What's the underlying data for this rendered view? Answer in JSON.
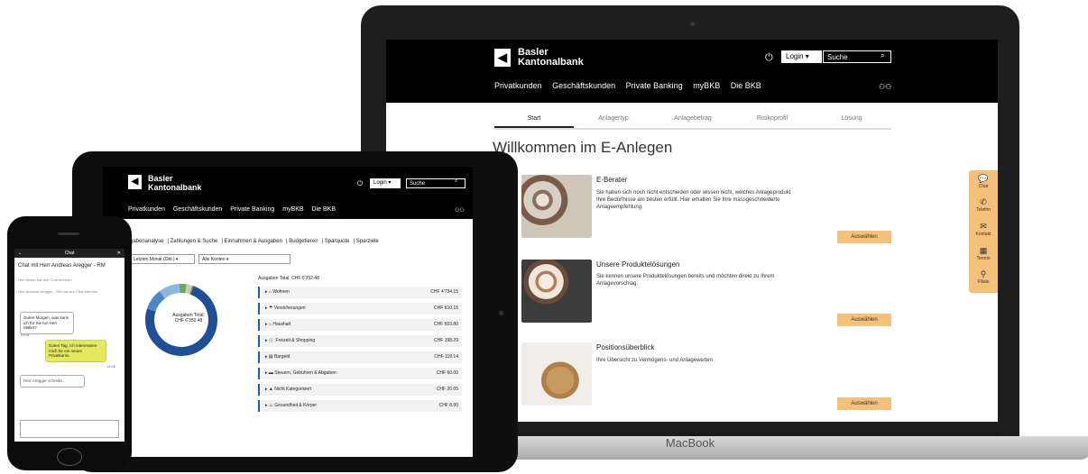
{
  "brand": {
    "line1": "Basler",
    "line2": "Kantonalbank"
  },
  "login_label": "Login",
  "search_placeholder": "Suche",
  "device_label": "MacBook",
  "nav": [
    "Privatkunden",
    "Geschäftskunden",
    "Private Banking",
    "myBKB",
    "Die BKB"
  ],
  "laptop": {
    "tabs": [
      "Start",
      "Anlagertyp",
      "Anlagebetrag",
      "Risikoprofil",
      "Lösung"
    ],
    "title": "Willkommen im E-Anlegen",
    "cards": [
      {
        "title": "E-Berater",
        "text": "Sie haben sich noch nicht entschieden oder wissen nicht, welches Anlageprodukt Ihre Bedürfnisse am besten erfüllt. Hier erhalten Sie Ihre massgeschneiderte Anlageempfehlung.",
        "button": "Auswählen"
      },
      {
        "title": "Unsere Produktelösungen",
        "text": "Sie kennen unsere Produktelösungen bereits und möchten direkt zu Ihrem Anlagevorschlag.",
        "button": "Auswählen"
      },
      {
        "title": "Positionsüberblick",
        "text": "Ihre Übersicht zu Vermögens- und Anlagewerten.",
        "button": "Auswählen"
      }
    ],
    "side": [
      "Chat",
      "Telefon",
      "Kontakt",
      "Termin",
      "Filiale"
    ]
  },
  "tablet": {
    "subnav": [
      "gabenanalyse",
      "Zahlungen & Suche",
      "Einnahmen & Ausgaben",
      "Budgetieren",
      "Sparquote",
      "Sparziele"
    ],
    "filter_period": "Letzten Monat (Okt.)",
    "filter_accounts": "Alle Konten",
    "donut_label": "Ausgaben Total:",
    "donut_value": "CHF 6'352.48",
    "total_label": "Ausgaben Total:  CHF 6'352.48",
    "rows": [
      {
        "label": "Wohnen",
        "value": "CHF 4'734.15"
      },
      {
        "label": "Versicherungen",
        "value": "CHF 610.15"
      },
      {
        "label": "Haushalt",
        "value": "CHF 603.80"
      },
      {
        "label": "Freizeit & Shopping",
        "value": "CHF 198.29"
      },
      {
        "label": "Bargeld",
        "value": "CHF 119.14"
      },
      {
        "label": "Steuern, Gebühren & Abgaben",
        "value": "CHF 60.00"
      },
      {
        "label": "Nicht Kategorisiert",
        "value": "CHF 20.05"
      },
      {
        "label": "Gesundheit & Körper",
        "value": "CHF 8.90"
      }
    ],
    "donut_colors": [
      "#1f4f95",
      "#4d87c7",
      "#8fb8e0",
      "#6aa84f",
      "#c9c9c9",
      "#e6c34a"
    ]
  },
  "phone": {
    "bar_title": "Chat",
    "chat_title": "Chat mit Herr Andreas Aregger - RM",
    "sys1": "Herr Müller hat den Chat betreten",
    "sys2": "Herr Andreas Aregger - RM hat den Chat betreten",
    "msg1": "Guten Morgen, was kann ich für Sie tun Herr Müller?",
    "time1": "13:05",
    "msg2": "Guten Tag, ich interessiere mich für ein neues Privatkonto.",
    "time2": "13:06",
    "typing": "Herr Aregger schreibt..."
  }
}
